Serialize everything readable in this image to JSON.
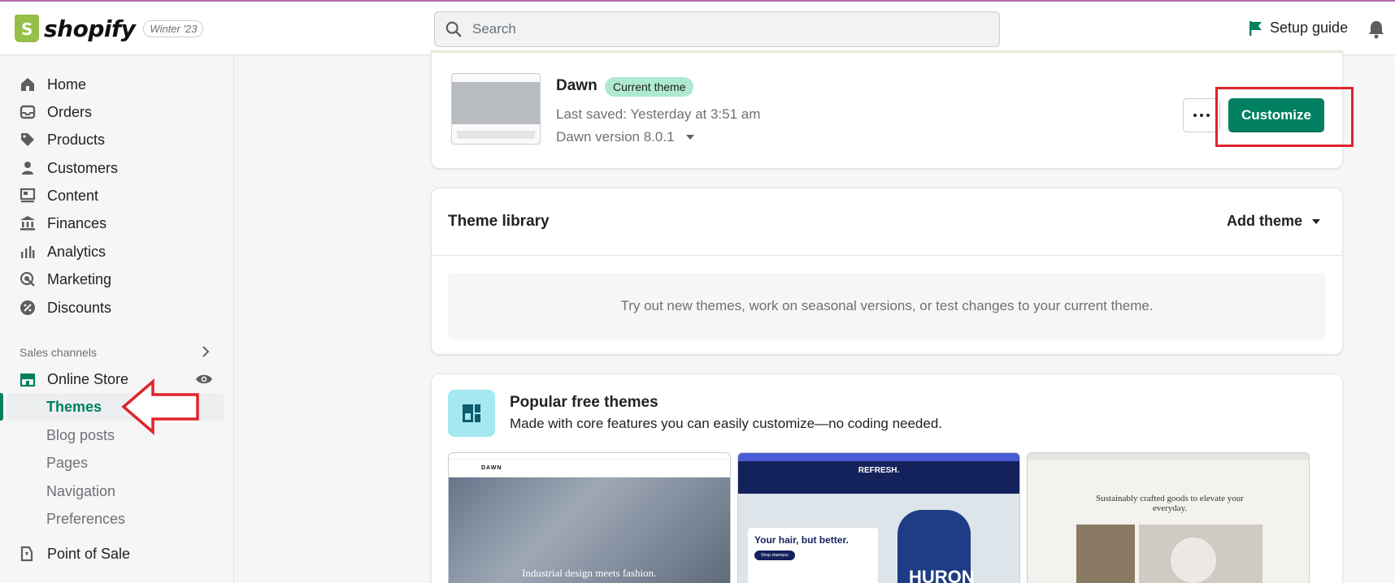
{
  "topbar": {
    "logo_text": "shopify",
    "version_badge": "Winter '23",
    "search_placeholder": "Search",
    "setup_guide": "Setup guide"
  },
  "sidebar": {
    "items": [
      {
        "label": "Home",
        "icon": "home-icon"
      },
      {
        "label": "Orders",
        "icon": "orders-icon"
      },
      {
        "label": "Products",
        "icon": "tag-icon"
      },
      {
        "label": "Customers",
        "icon": "person-icon"
      },
      {
        "label": "Content",
        "icon": "content-icon"
      },
      {
        "label": "Finances",
        "icon": "bank-icon"
      },
      {
        "label": "Analytics",
        "icon": "bar-chart-icon"
      },
      {
        "label": "Marketing",
        "icon": "target-icon"
      },
      {
        "label": "Discounts",
        "icon": "discount-icon"
      }
    ],
    "sales_channels_label": "Sales channels",
    "online_store": "Online Store",
    "sub_items": [
      "Themes",
      "Blog posts",
      "Pages",
      "Navigation",
      "Preferences"
    ],
    "point_of_sale": "Point of Sale"
  },
  "current_theme": {
    "name": "Dawn",
    "badge": "Current theme",
    "last_saved": "Last saved: Yesterday at 3:51 am",
    "version": "Dawn version 8.0.1",
    "customize_label": "Customize"
  },
  "library": {
    "title": "Theme library",
    "add_theme": "Add theme",
    "empty_text": "Try out new themes, work on seasonal versions, or test changes to your current theme."
  },
  "popular": {
    "title": "Popular free themes",
    "subtitle": "Made with core features you can easily customize—no coding needed.",
    "previews": [
      {
        "brand": "DAWN",
        "hero_text": "Industrial design meets fashion."
      },
      {
        "brand": "REFRESH.",
        "headline": "Your hair, but better.",
        "product": "HURON",
        "button": "Shop shampoo"
      },
      {
        "tagline": "Sustainably crafted goods to elevate your everyday."
      }
    ]
  },
  "colors": {
    "accent": "#008060",
    "badge": "#aee9d1",
    "annotation": "#e0242b"
  }
}
